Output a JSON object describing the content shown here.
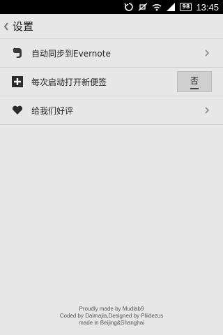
{
  "status_bar": {
    "time": "13:45",
    "battery": "98"
  },
  "header": {
    "title": "设置"
  },
  "settings": [
    {
      "icon": "evernote-icon",
      "label": "自动同步到Evernote",
      "control": "chevron"
    },
    {
      "icon": "plus-box-icon",
      "label": "每次启动打开新便签",
      "control": "toggle",
      "value": "否"
    },
    {
      "icon": "heart-icon",
      "label": "给我们好评",
      "control": "chevron"
    }
  ],
  "footer": {
    "line1": "Proudly made by Mudlab9",
    "line2": "Coded by Daimajia,Designed by Pliidezus",
    "line3": "made in Beijing&Shanghai"
  }
}
